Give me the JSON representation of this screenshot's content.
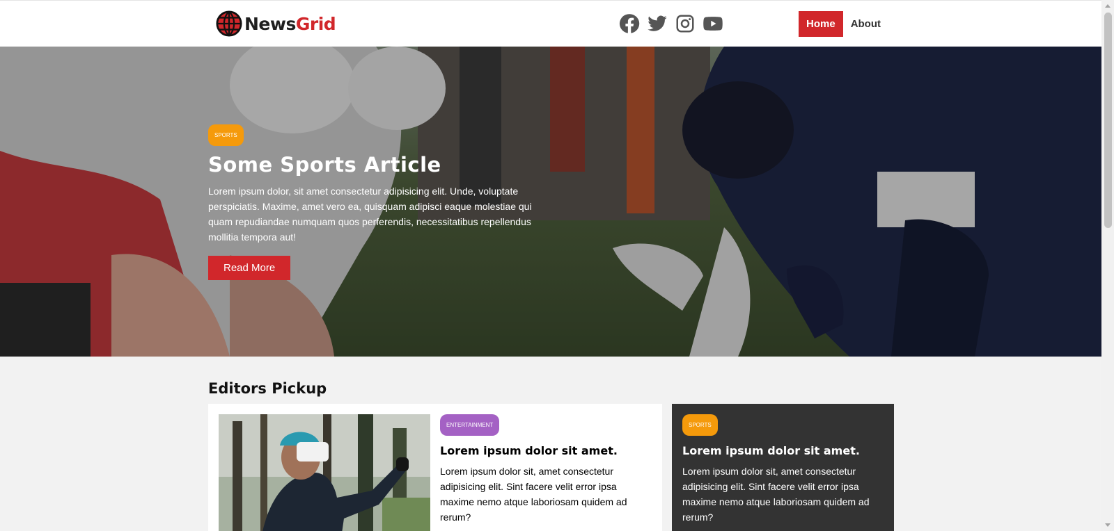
{
  "header": {
    "logo_news": "News",
    "logo_grid": "Grid",
    "socials": [
      "facebook-icon",
      "twitter-icon",
      "instagram-icon",
      "youtube-icon"
    ],
    "nav": {
      "home": "Home",
      "about": "About"
    }
  },
  "hero": {
    "badge": "SPORTS",
    "title": "Some Sports Article",
    "text": "Lorem ipsum dolor, sit amet consectetur adipisicing elit. Unde, voluptate perspiciatis. Maxime, amet vero ea, quisquam adipisci eaque molestiae qui quam repudiandae numquam quos perferendis, necessitatibus repellendus mollitia tempora aut!",
    "button": "Read More"
  },
  "editors": {
    "title": "Editors Pickup",
    "main_card": {
      "badge": "ENTERTAINMENT",
      "title": "Lorem ipsum dolor sit amet.",
      "text": "Lorem ipsum dolor sit, amet consectetur adipisicing elit. Sint facere velit error ipsa maxime nemo atque laboriosam quidem ad rerum?"
    },
    "side_card": {
      "badge": "SPORTS",
      "title": "Lorem ipsum dolor sit amet.",
      "text": "Lorem ipsum dolor sit, amet consectetur adipisicing elit. Sint facere velit error ipsa maxime nemo atque laboriosam quidem ad rerum?"
    }
  },
  "colors": {
    "brand_red": "#d1272b",
    "sports_orange": "#f59a0b",
    "entertainment_purple": "#a461c4",
    "dark_card": "#333333"
  }
}
